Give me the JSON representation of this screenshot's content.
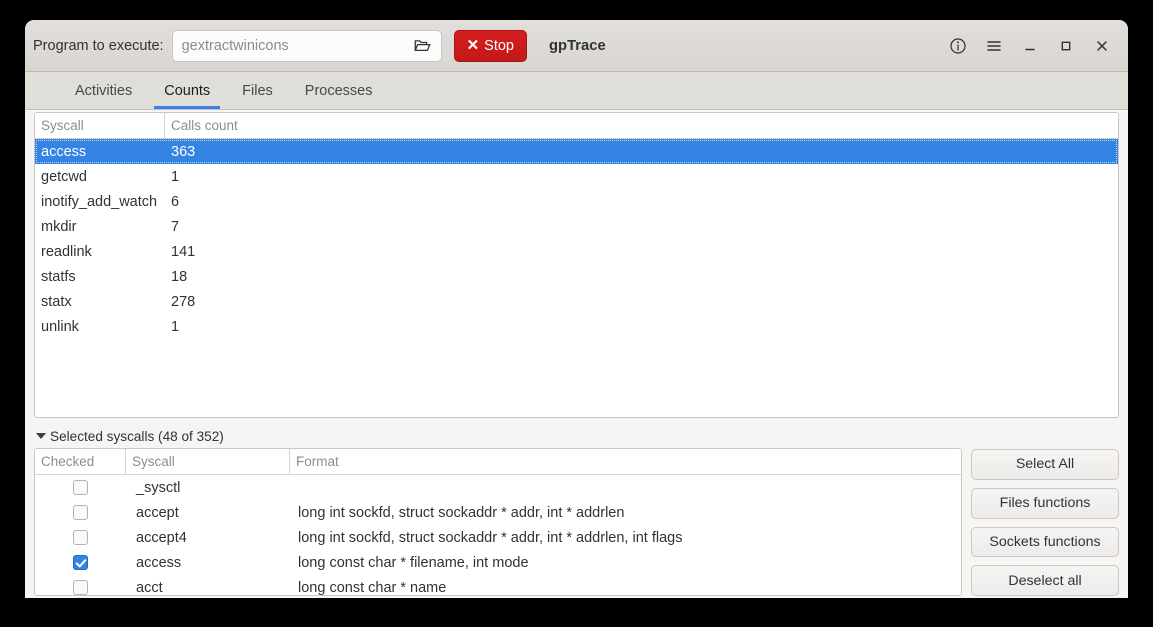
{
  "header": {
    "program_label": "Program to execute:",
    "program_value": "gextractwinicons",
    "program_placeholder": "gextractwinicons",
    "folder_icon": "folder-open-icon",
    "stop_label": "Stop",
    "stop_icon": "close-x-icon",
    "app_title": "gpTrace",
    "accent_red": "#c4191a",
    "window_buttons": [
      {
        "name": "info-button",
        "icon": "info-circle-icon"
      },
      {
        "name": "menu-button",
        "icon": "hamburger-menu-icon"
      },
      {
        "name": "minimize-button",
        "icon": "minimize-icon"
      },
      {
        "name": "maximize-button",
        "icon": "maximize-icon"
      },
      {
        "name": "close-button",
        "icon": "close-icon"
      }
    ]
  },
  "tabs": [
    {
      "label": "Activities",
      "active": false
    },
    {
      "label": "Counts",
      "active": true
    },
    {
      "label": "Files",
      "active": false
    },
    {
      "label": "Processes",
      "active": false
    }
  ],
  "accent_blue": "#3584e4",
  "counts_table": {
    "columns": [
      "Syscall",
      "Calls count"
    ],
    "rows": [
      {
        "syscall": "access",
        "count": "363",
        "selected": true
      },
      {
        "syscall": "getcwd",
        "count": "1",
        "selected": false
      },
      {
        "syscall": "inotify_add_watch",
        "count": "6",
        "selected": false
      },
      {
        "syscall": "mkdir",
        "count": "7",
        "selected": false
      },
      {
        "syscall": "readlink",
        "count": "141",
        "selected": false
      },
      {
        "syscall": "statfs",
        "count": "18",
        "selected": false
      },
      {
        "syscall": "statx",
        "count": "278",
        "selected": false
      },
      {
        "syscall": "unlink",
        "count": "1",
        "selected": false
      }
    ]
  },
  "expander": {
    "label": "Selected syscalls (48 of 352)",
    "expanded": true,
    "selected_count": 48,
    "total_count": 352
  },
  "syscalls_table": {
    "columns": [
      "Checked",
      "Syscall",
      "Format"
    ],
    "rows": [
      {
        "checked": false,
        "syscall": "_sysctl",
        "format": ""
      },
      {
        "checked": false,
        "syscall": "accept",
        "format": "long int sockfd, struct sockaddr * addr, int * addrlen"
      },
      {
        "checked": false,
        "syscall": "accept4",
        "format": "long int sockfd, struct sockaddr * addr, int * addrlen, int flags"
      },
      {
        "checked": true,
        "syscall": "access",
        "format": "long const char * filename, int mode"
      },
      {
        "checked": false,
        "syscall": "acct",
        "format": "long const char * name"
      }
    ]
  },
  "side_buttons": [
    {
      "label": "Select All"
    },
    {
      "label": "Files functions"
    },
    {
      "label": "Sockets functions"
    },
    {
      "label": "Deselect all"
    }
  ]
}
